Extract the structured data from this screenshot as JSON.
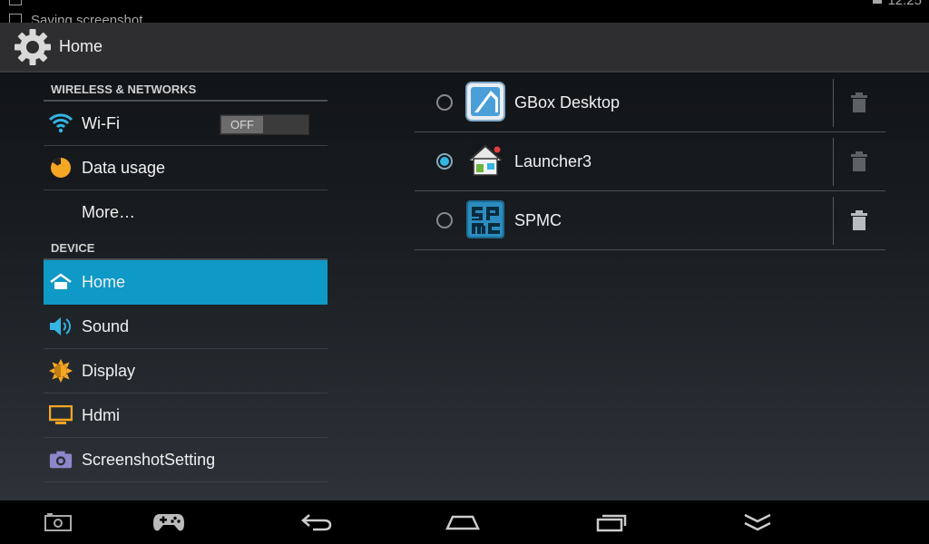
{
  "status_bar": {
    "notification_text": "Saving screenshot",
    "clock": "12:25"
  },
  "action_bar": {
    "icon": "settings-gear-icon",
    "title": "Home"
  },
  "sidebar": {
    "sections": [
      {
        "header": "WIRELESS & NETWORKS",
        "items": [
          {
            "label": "Wi-Fi",
            "icon": "wifi-icon",
            "toggle": "OFF"
          },
          {
            "label": "Data usage",
            "icon": "data-usage-icon"
          },
          {
            "label": "More…",
            "icon": ""
          }
        ]
      },
      {
        "header": "DEVICE",
        "items": [
          {
            "label": "Home",
            "icon": "home-icon",
            "selected": true
          },
          {
            "label": "Sound",
            "icon": "speaker-icon"
          },
          {
            "label": "Display",
            "icon": "brightness-icon"
          },
          {
            "label": "Hdmi",
            "icon": "monitor-icon"
          },
          {
            "label": "ScreenshotSetting",
            "icon": "camera-icon"
          }
        ]
      }
    ]
  },
  "home_apps": [
    {
      "name": "GBox Desktop",
      "icon": "gbox-desktop-icon",
      "selected": false
    },
    {
      "name": "Launcher3",
      "icon": "launcher-house-icon",
      "selected": true
    },
    {
      "name": "SPMC",
      "icon": "spmc-icon",
      "selected": false
    }
  ],
  "nav_bar": [
    "screenshot-icon",
    "gamepad-icon",
    "back-icon",
    "home-icon",
    "recents-icon",
    "collapse-icon"
  ],
  "colors": {
    "accent": "#0e99c6",
    "radio_selected": "#33b5e5"
  }
}
